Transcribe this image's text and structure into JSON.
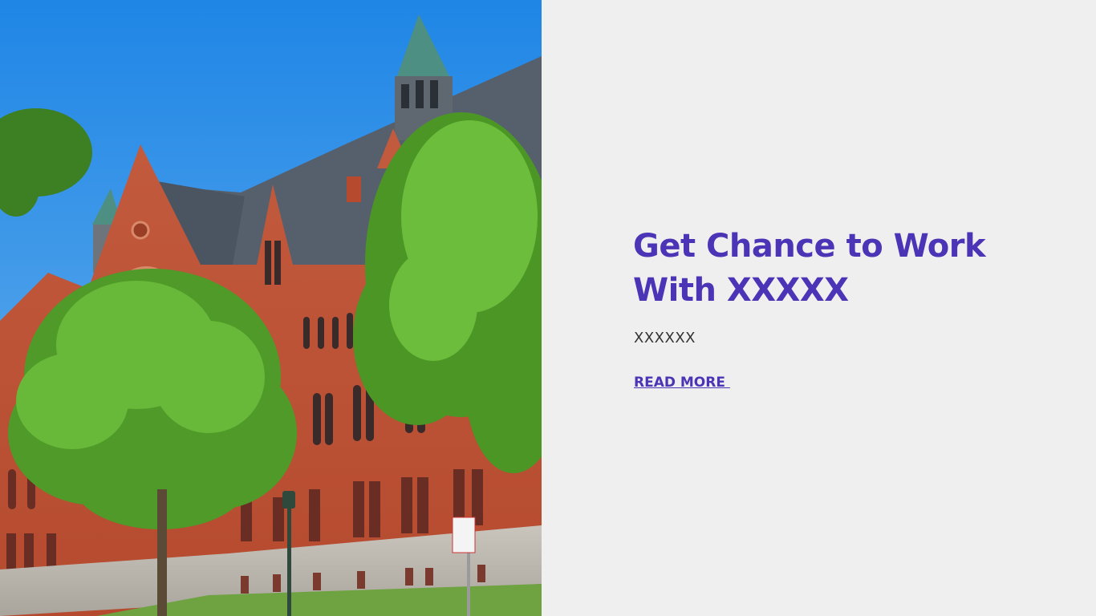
{
  "hero": {
    "image_alt": "Red brick university building with trees"
  },
  "content": {
    "headline_line1": "Get Chance to Work",
    "headline_line2": "With XXXXX",
    "subtext": "XXXXXX",
    "read_more_label": "READ MORE "
  },
  "colors": {
    "accent": "#4b34b5",
    "panel_background": "#efefef",
    "sky": "#2f8fe0",
    "brick": "#c0583a",
    "roof": "#55606e",
    "foliage": "#5da42f"
  }
}
